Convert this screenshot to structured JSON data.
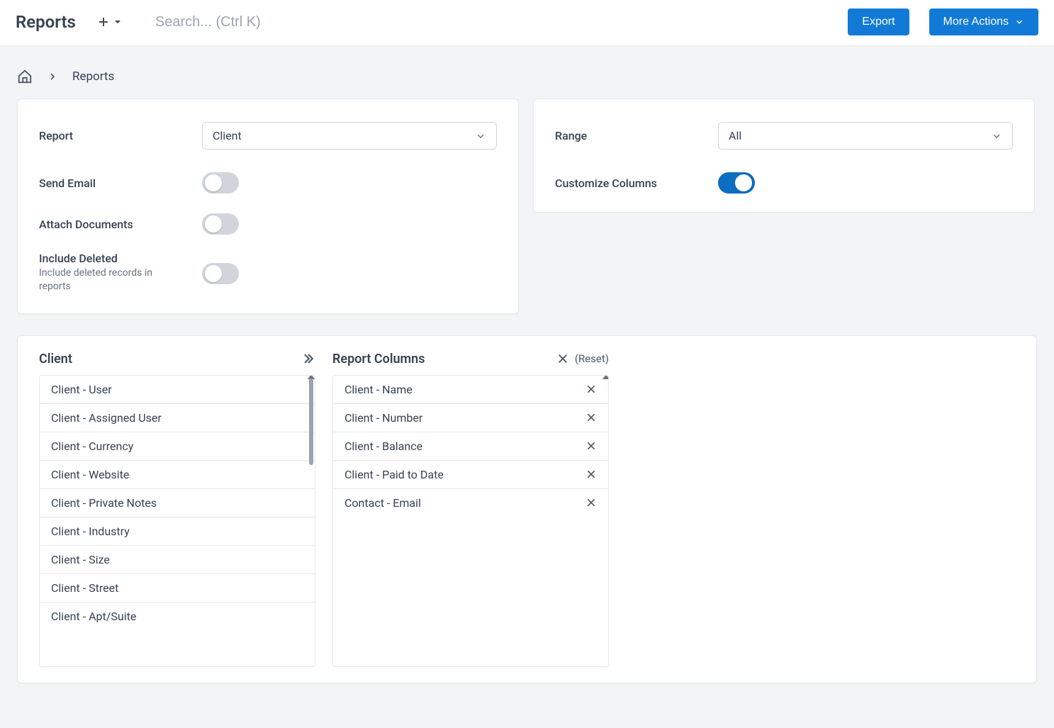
{
  "header": {
    "title": "Reports",
    "search_placeholder": "Search... (Ctrl K)",
    "export_label": "Export",
    "more_actions_label": "More Actions"
  },
  "breadcrumb": {
    "current": "Reports"
  },
  "panel_left": {
    "report_label": "Report",
    "report_value": "Client",
    "send_email_label": "Send Email",
    "send_email_on": false,
    "attach_docs_label": "Attach Documents",
    "attach_docs_on": false,
    "include_deleted_label": "Include Deleted",
    "include_deleted_sub": "Include deleted records in reports",
    "include_deleted_on": false
  },
  "panel_right": {
    "range_label": "Range",
    "range_value": "All",
    "customize_label": "Customize Columns",
    "customize_on": true
  },
  "columns": {
    "available_title": "Client",
    "selected_title": "Report Columns",
    "reset_label": "(Reset)",
    "available": [
      "Client - User",
      "Client - Assigned User",
      "Client - Currency",
      "Client - Website",
      "Client - Private Notes",
      "Client - Industry",
      "Client - Size",
      "Client - Street",
      "Client - Apt/Suite"
    ],
    "selected": [
      "Client - Name",
      "Client - Number",
      "Client - Balance",
      "Client - Paid to Date",
      "Contact - Email"
    ]
  }
}
